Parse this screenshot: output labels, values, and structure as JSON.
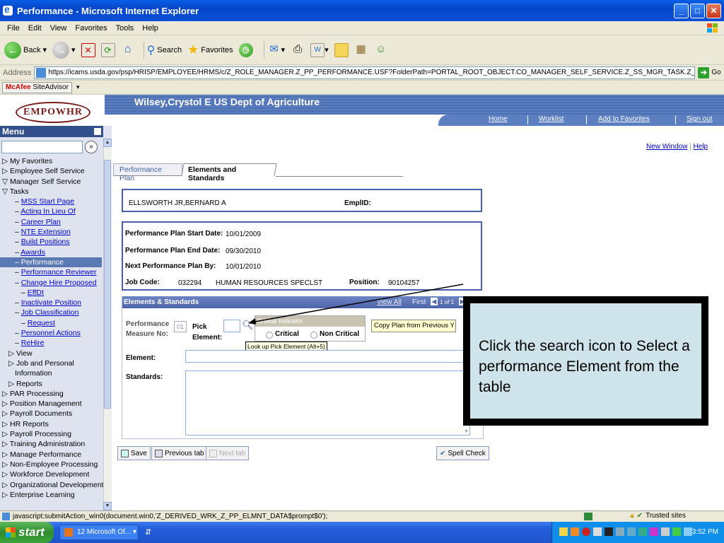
{
  "window": {
    "title": "Performance - Microsoft Internet Explorer"
  },
  "menubar": [
    "File",
    "Edit",
    "View",
    "Favorites",
    "Tools",
    "Help"
  ],
  "toolbar": {
    "back": "Back",
    "search": "Search",
    "favorites": "Favorites"
  },
  "address": {
    "label": "Address",
    "url": "https://icams.usda.gov/psp/HRISP/EMPLOYEE/HRMS/c/Z_ROLE_MANAGER.Z_PP_PERFORMANCE.USF?FolderPath=PORTAL_ROOT_OBJECT.CO_MANAGER_SELF_SERVICE.Z_SS_MGR_TASK.Z_PP_PERFORMANCE_USF_1&IsFolder=false",
    "go": "Go"
  },
  "mcafee": {
    "brand": "McAfee",
    "label": "SiteAdvisor"
  },
  "header": {
    "username": "Wilsey,Crystol E  US Dept of Agriculture",
    "logo": "EMPOWHR",
    "links": [
      "Home",
      "Worklist",
      "Add to Favorites",
      "Sign out"
    ]
  },
  "menu": {
    "title": "Menu",
    "items": [
      {
        "text": "▷ My Favorites",
        "link": false
      },
      {
        "text": "▷ Employee Self Service",
        "link": false
      },
      {
        "text": "▽ Manager Self Service",
        "link": false
      },
      {
        "text": "  ▽ Tasks",
        "link": false
      },
      {
        "text": "MSS Start Page",
        "link": true,
        "indent": 2
      },
      {
        "text": "Acting In Lieu Of",
        "link": true,
        "indent": 2
      },
      {
        "text": "Career Plan",
        "link": true,
        "indent": 2
      },
      {
        "text": "NTE Extension",
        "link": true,
        "indent": 2
      },
      {
        "text": "Build Positions",
        "link": true,
        "indent": 2
      },
      {
        "text": "Awards",
        "link": true,
        "indent": 2
      },
      {
        "text": "Performance",
        "link": false,
        "indent": 2,
        "selected": true
      },
      {
        "text": "Performance Reviewer",
        "link": true,
        "indent": 2
      },
      {
        "text": "Change Hire Proposed",
        "link": true,
        "indent": 2
      },
      {
        "text": "EffDt",
        "link": true,
        "indent": 3
      },
      {
        "text": "Inactivate Position",
        "link": true,
        "indent": 2
      },
      {
        "text": "Job Classification",
        "link": true,
        "indent": 2
      },
      {
        "text": "Request",
        "link": true,
        "indent": 3
      },
      {
        "text": "Personnel Actions",
        "link": true,
        "indent": 2
      },
      {
        "text": "ReHire",
        "link": true,
        "indent": 2
      },
      {
        "text": "▷ View",
        "link": false,
        "indent": 1
      },
      {
        "text": "▷ Job and Personal",
        "link": false,
        "indent": 1
      },
      {
        "text": "Information",
        "link": false,
        "indent": 2
      },
      {
        "text": "▷ Reports",
        "link": false,
        "indent": 1
      },
      {
        "text": "▷ PAR Processing",
        "link": false
      },
      {
        "text": "▷ Position Management",
        "link": false
      },
      {
        "text": "▷ Payroll Documents",
        "link": false
      },
      {
        "text": "▷ HR Reports",
        "link": false
      },
      {
        "text": "▷ Payroll Processing",
        "link": false
      },
      {
        "text": "▷ Training Administration",
        "link": false
      },
      {
        "text": "▷ Manage Performance",
        "link": false
      },
      {
        "text": "▷ Non-Employee Processing",
        "link": false
      },
      {
        "text": "▷ Workforce Development",
        "link": false
      },
      {
        "text": "▷ Organizational Development",
        "link": false
      },
      {
        "text": "▷ Enterprise Learning",
        "link": false
      }
    ]
  },
  "page": {
    "new_window": "New Window",
    "help": "Help",
    "tabs": [
      "Performance Plan",
      "Elements and Standards"
    ],
    "employee_name": "ELLSWORTH JR,BERNARD A",
    "emplid_label": "EmplID:",
    "plan_start_label": "Performance Plan Start Date:",
    "plan_start": "10/01/2009",
    "plan_end_label": "Performance Plan End Date:",
    "plan_end": "09/30/2010",
    "next_plan_label": "Next Performance Plan By:",
    "next_plan": "10/01/2010",
    "job_code_label": "Job Code:",
    "job_code": "032294",
    "job_title": "HUMAN RESOURCES SPECLST",
    "position_label": "Position:",
    "position": "90104257",
    "section_title": "Elements & Standards",
    "view_all": "View All",
    "first": "First",
    "pager": "1 of 1",
    "perf_measure_label": "Performance Measure No:",
    "perf_measure_value": "01",
    "pick_element_label": "Pick Element:",
    "critical_indicator": "Critical Indicator",
    "critical": "Critical",
    "non_critical": "Non Critical",
    "copy_plan": "Copy Plan from Previous Y",
    "tooltip": "Look up Pick Element (Alt+5)",
    "element_label": "Element:",
    "standards_label": "Standards:",
    "save": "Save",
    "previous_tab": "Previous tab",
    "next_tab": "Next tab",
    "spell_check": "Spell Check"
  },
  "callout": "Click the search icon to Select a performance Element from the table",
  "status": {
    "text": "javascript:submitAction_win0(document.win0,'Z_DERIVED_WRK_Z_PP_ELMNT_DATA$prompt$0');",
    "zone": "Trusted sites"
  },
  "taskbar": {
    "start": "start",
    "item": "12 Microsoft Of...",
    "clock": "3:52 PM"
  },
  "colors": {
    "accent": "#4a5ea8",
    "callout_bg": "#cfe3ea",
    "menu_selected": "#5a78b4"
  }
}
